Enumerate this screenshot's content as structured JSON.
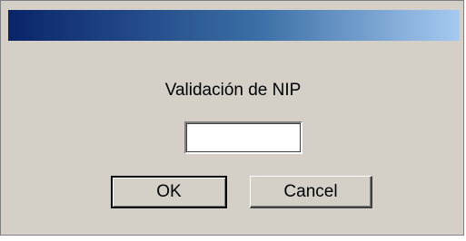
{
  "window": {
    "title": ""
  },
  "dialog": {
    "heading": "Validación de NIP",
    "pin_field": {
      "value": "",
      "placeholder": ""
    },
    "buttons": {
      "ok_label": "OK",
      "cancel_label": "Cancel"
    }
  },
  "colors": {
    "titlebar_start": "#0a246a",
    "titlebar_end": "#a6caf0",
    "dialog_background": "#d4d0c8"
  }
}
